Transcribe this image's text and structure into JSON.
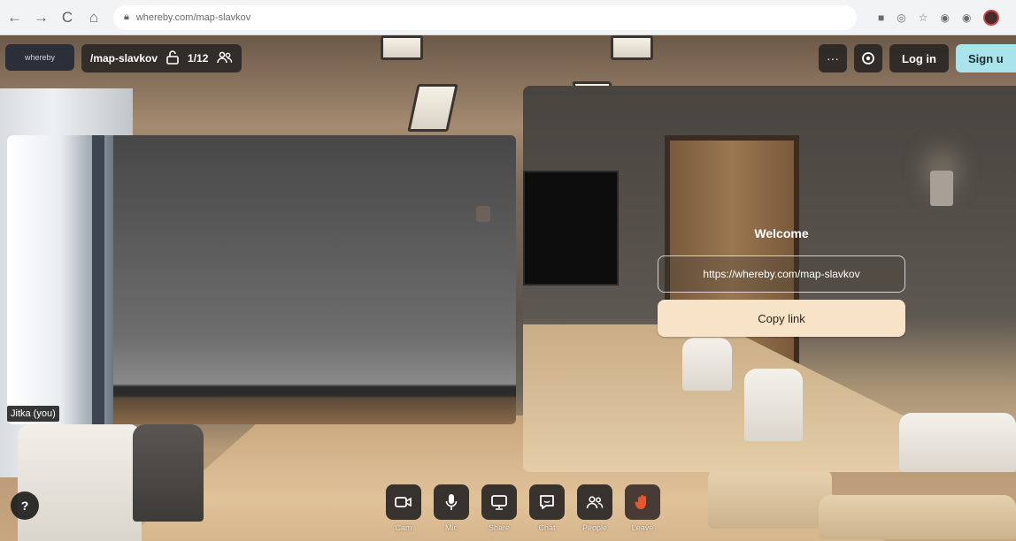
{
  "browser": {
    "url": "whereby.com/map-slavkov",
    "nav": {
      "back": "←",
      "forward": "→",
      "reload": "C",
      "home": "⌂"
    }
  },
  "app": {
    "logo_text": "whereby",
    "room_name": "/map-slavkov",
    "participants": "1/12",
    "more_label": "···",
    "login_label": "Log in",
    "signup_label": "Sign u"
  },
  "self_video": {
    "name": "Jitka (you)"
  },
  "welcome": {
    "title": "Welcome",
    "link": "https://whereby.com/map-slavkov",
    "copy_label": "Copy link"
  },
  "toolbar": {
    "cam": "Cam",
    "mic": "Mic",
    "share": "Share",
    "chat": "Chat",
    "people": "People",
    "leave": "Leave"
  },
  "help_label": "?",
  "colors": {
    "accent_signup": "#a9e3ec",
    "copy_button": "#f7e3c8",
    "leave_icon": "#e8572c",
    "toolbar_bg": "#282624"
  }
}
